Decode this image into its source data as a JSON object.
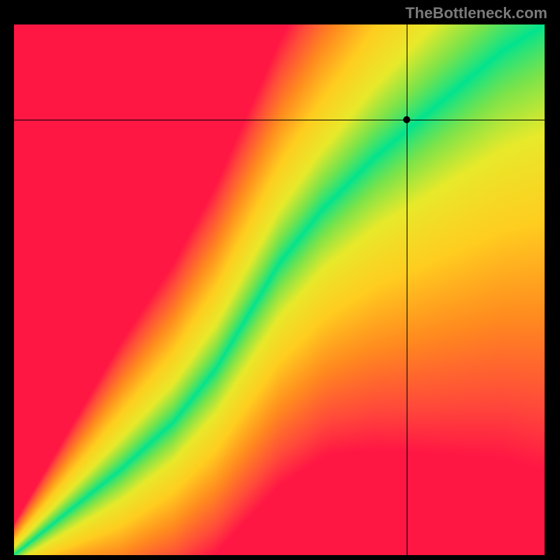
{
  "attribution": "TheBottleneck.com",
  "chart_data": {
    "type": "heatmap",
    "title": "",
    "xlabel": "",
    "ylabel": "",
    "xlim": [
      0,
      100
    ],
    "ylim": [
      0,
      100
    ],
    "crosshair": {
      "x": 74,
      "y": 82
    },
    "ridge": [
      {
        "x": 0,
        "y": 0
      },
      {
        "x": 10,
        "y": 8
      },
      {
        "x": 20,
        "y": 16
      },
      {
        "x": 30,
        "y": 25
      },
      {
        "x": 38,
        "y": 35
      },
      {
        "x": 44,
        "y": 45
      },
      {
        "x": 50,
        "y": 55
      },
      {
        "x": 58,
        "y": 65
      },
      {
        "x": 68,
        "y": 75
      },
      {
        "x": 80,
        "y": 85
      },
      {
        "x": 92,
        "y": 95
      },
      {
        "x": 100,
        "y": 100
      }
    ],
    "ridge_width": [
      {
        "x": 0,
        "w": 1
      },
      {
        "x": 20,
        "w": 4
      },
      {
        "x": 40,
        "w": 6
      },
      {
        "x": 60,
        "w": 8
      },
      {
        "x": 80,
        "w": 11
      },
      {
        "x": 100,
        "w": 14
      }
    ],
    "color_stops": [
      {
        "t": 0.0,
        "color": "#00e38f"
      },
      {
        "t": 0.15,
        "color": "#7be34a"
      },
      {
        "t": 0.3,
        "color": "#e8e92a"
      },
      {
        "t": 0.5,
        "color": "#ffcd1f"
      },
      {
        "t": 0.7,
        "color": "#ff8a1f"
      },
      {
        "t": 0.88,
        "color": "#ff4a3a"
      },
      {
        "t": 1.0,
        "color": "#ff1744"
      }
    ]
  }
}
